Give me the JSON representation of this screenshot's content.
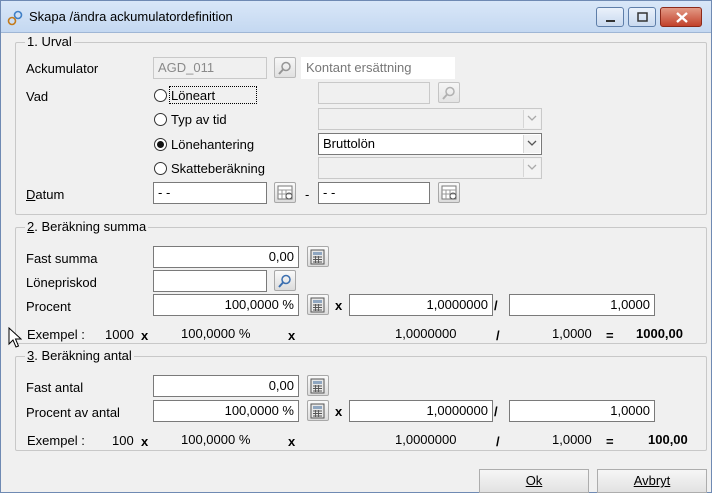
{
  "window": {
    "title": "Skapa /ändra ackumulatordefinition"
  },
  "urval": {
    "legend": "1. Urval",
    "ackumulator_label": "Ackumulator",
    "ackumulator_value": "AGD_011",
    "ackumulator_desc": "Kontant ersättning",
    "vad_label": "Vad",
    "options": [
      {
        "label": "Löneart",
        "checked": false
      },
      {
        "label": "Typ av tid",
        "checked": false
      },
      {
        "label": "Lönehantering",
        "checked": true
      },
      {
        "label": "Skatteberäkning",
        "checked": false
      }
    ],
    "lonehantering_value": "Bruttolön",
    "datum_label": "Datum",
    "datum_from": " - -",
    "datum_separator": "-",
    "datum_to": " - -"
  },
  "summa": {
    "legend": "2. Beräkning summa",
    "fast_summa_label": "Fast summa",
    "fast_summa_value": "0,00",
    "lonepriskod_label": "Lönepriskod",
    "lonepriskod_value": "",
    "procent_label": "Procent",
    "procent_value": "100,0000 %",
    "mult_value": "1,0000000",
    "div_value": "1,0000",
    "exempel_label": "Exempel :",
    "exempel_base": "1000",
    "exempel_pct": "100,0000 %",
    "exempel_mult": "1,0000000",
    "exempel_div": "1,0000",
    "exempel_result": "1000,00"
  },
  "antal": {
    "legend": "3. Beräkning antal",
    "fast_antal_label": "Fast antal",
    "fast_antal_value": "0,00",
    "procent_label": "Procent av antal",
    "procent_value": "100,0000 %",
    "mult_value": "1,0000000",
    "div_value": "1,0000",
    "exempel_label": "Exempel :",
    "exempel_base": "100",
    "exempel_pct": "100,0000 %",
    "exempel_mult": "1,0000000",
    "exempel_div": "1,0000",
    "exempel_result": "100,00"
  },
  "operators": {
    "times": "x",
    "divide": "/",
    "equals": "="
  },
  "buttons": {
    "ok": "Ok",
    "cancel": "Avbryt"
  }
}
